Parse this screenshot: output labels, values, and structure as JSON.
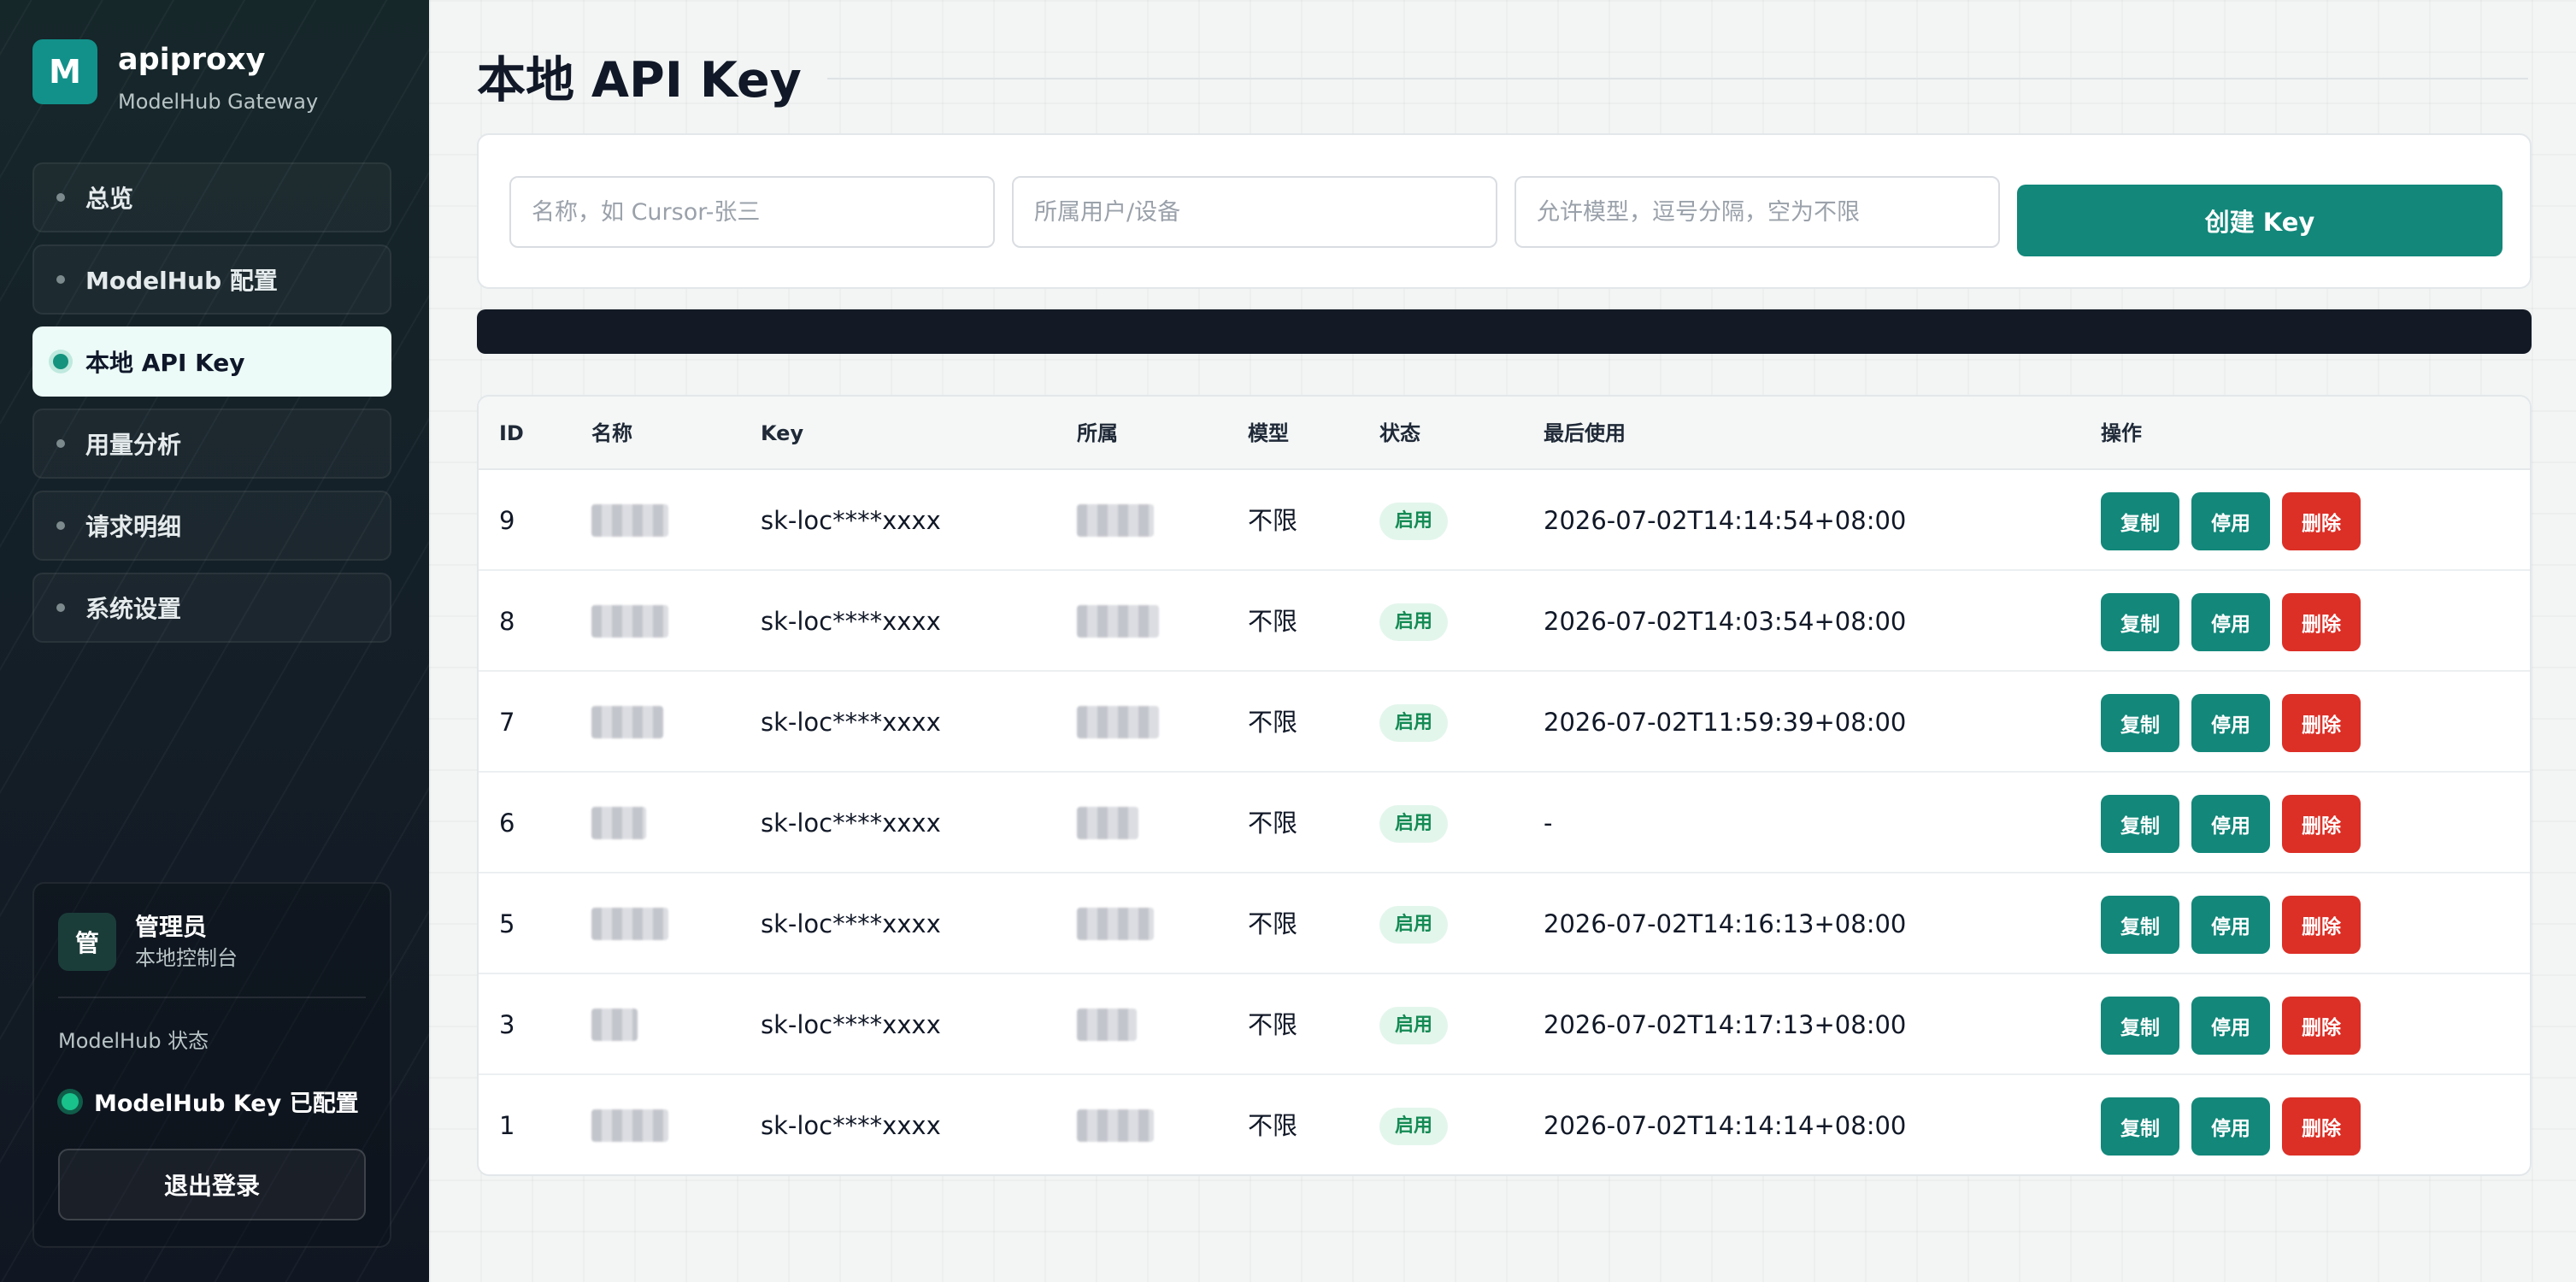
{
  "brand": {
    "logo_letter": "M",
    "name": "apiproxy",
    "subtitle": "ModelHub Gateway"
  },
  "nav": [
    {
      "label": "总览",
      "active": false
    },
    {
      "label": "ModelHub 配置",
      "active": false
    },
    {
      "label": "本地 API Key",
      "active": true
    },
    {
      "label": "用量分析",
      "active": false
    },
    {
      "label": "请求明细",
      "active": false
    },
    {
      "label": "系统设置",
      "active": false
    }
  ],
  "admin": {
    "avatar": "管",
    "name": "管理员",
    "role": "本地控制台",
    "status_label": "ModelHub 状态",
    "status_text": "ModelHub Key 已配置",
    "logout": "退出登录"
  },
  "page": {
    "title": "本地 API Key"
  },
  "form": {
    "name_placeholder": "名称，如 Cursor-张三",
    "owner_placeholder": "所属用户/设备",
    "models_placeholder": "允许模型，逗号分隔，空为不限",
    "create_label": "创建 Key"
  },
  "table": {
    "headers": {
      "id": "ID",
      "name": "名称",
      "key": "Key",
      "owner": "所属",
      "model": "模型",
      "status": "状态",
      "last_used": "最后使用",
      "actions": "操作"
    },
    "rows": [
      {
        "id": "9",
        "key": "sk-loc****xxxx",
        "model": "不限",
        "status": "启用",
        "last_used": "2026-07-02T14:14:54+08:00"
      },
      {
        "id": "8",
        "key": "sk-loc****xxxx",
        "model": "不限",
        "status": "启用",
        "last_used": "2026-07-02T14:03:54+08:00"
      },
      {
        "id": "7",
        "key": "sk-loc****xxxx",
        "model": "不限",
        "status": "启用",
        "last_used": "2026-07-02T11:59:39+08:00"
      },
      {
        "id": "6",
        "key": "sk-loc****xxxx",
        "model": "不限",
        "status": "启用",
        "last_used": "-"
      },
      {
        "id": "5",
        "key": "sk-loc****xxxx",
        "model": "不限",
        "status": "启用",
        "last_used": "2026-07-02T14:16:13+08:00"
      },
      {
        "id": "3",
        "key": "sk-loc****xxxx",
        "model": "不限",
        "status": "启用",
        "last_used": "2026-07-02T14:17:13+08:00"
      },
      {
        "id": "1",
        "key": "sk-loc****xxxx",
        "model": "不限",
        "status": "启用",
        "last_used": "2026-07-02T14:14:14+08:00"
      }
    ],
    "actions": {
      "copy": "复制",
      "disable": "停用",
      "delete": "删除"
    }
  },
  "colors": {
    "accent": "#12877a",
    "danger": "#dc2f26",
    "sidebar_bg": "#141e27",
    "badge_bg": "#e3f6ec",
    "badge_text": "#148a54"
  }
}
